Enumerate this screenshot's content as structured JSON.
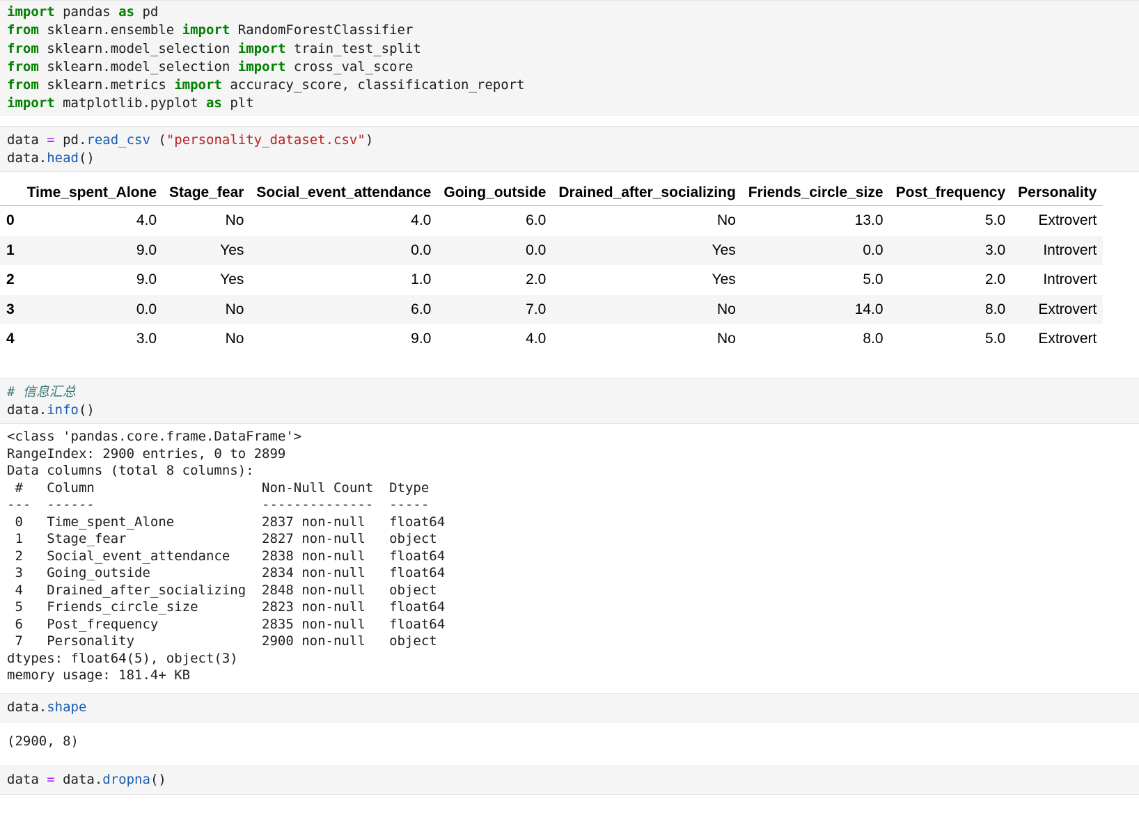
{
  "cell1": {
    "lines": [
      [
        {
          "t": "import",
          "c": "kw"
        },
        {
          "t": " pandas "
        },
        {
          "t": "as",
          "c": "kw"
        },
        {
          "t": " pd"
        }
      ],
      [
        {
          "t": "from",
          "c": "kw"
        },
        {
          "t": " sklearn.ensemble "
        },
        {
          "t": "import",
          "c": "kw"
        },
        {
          "t": " RandomForestClassifier"
        }
      ],
      [
        {
          "t": "from",
          "c": "kw"
        },
        {
          "t": " sklearn.model_selection "
        },
        {
          "t": "import",
          "c": "kw"
        },
        {
          "t": " train_test_split"
        }
      ],
      [
        {
          "t": "from",
          "c": "kw"
        },
        {
          "t": " sklearn.model_selection "
        },
        {
          "t": "import",
          "c": "kw"
        },
        {
          "t": " cross_val_score"
        }
      ],
      [
        {
          "t": "from",
          "c": "kw"
        },
        {
          "t": " sklearn.metrics "
        },
        {
          "t": "import",
          "c": "kw"
        },
        {
          "t": " accuracy_score, classification_report"
        }
      ],
      [
        {
          "t": "import",
          "c": "kw"
        },
        {
          "t": " matplotlib.pyplot "
        },
        {
          "t": "as",
          "c": "kw"
        },
        {
          "t": " plt"
        }
      ]
    ]
  },
  "cell2": {
    "lines": [
      [
        {
          "t": "data "
        },
        {
          "t": "=",
          "c": "op"
        },
        {
          "t": " pd."
        },
        {
          "t": "read_csv",
          "c": "fn"
        },
        {
          "t": " ("
        },
        {
          "t": "\"personality_dataset.csv\"",
          "c": "str"
        },
        {
          "t": ")"
        }
      ],
      [
        {
          "t": "data."
        },
        {
          "t": "head",
          "c": "fn"
        },
        {
          "t": "()"
        }
      ]
    ]
  },
  "table": {
    "columns": [
      "",
      "Time_spent_Alone",
      "Stage_fear",
      "Social_event_attendance",
      "Going_outside",
      "Drained_after_socializing",
      "Friends_circle_size",
      "Post_frequency",
      "Personality"
    ],
    "rows": [
      [
        "0",
        "4.0",
        "No",
        "4.0",
        "6.0",
        "No",
        "13.0",
        "5.0",
        "Extrovert"
      ],
      [
        "1",
        "9.0",
        "Yes",
        "0.0",
        "0.0",
        "Yes",
        "0.0",
        "3.0",
        "Introvert"
      ],
      [
        "2",
        "9.0",
        "Yes",
        "1.0",
        "2.0",
        "Yes",
        "5.0",
        "2.0",
        "Introvert"
      ],
      [
        "3",
        "0.0",
        "No",
        "6.0",
        "7.0",
        "No",
        "14.0",
        "8.0",
        "Extrovert"
      ],
      [
        "4",
        "3.0",
        "No",
        "9.0",
        "4.0",
        "No",
        "8.0",
        "5.0",
        "Extrovert"
      ]
    ]
  },
  "cell3": {
    "lines": [
      [
        {
          "t": "# 信息汇总",
          "c": "cm"
        }
      ],
      [
        {
          "t": "data."
        },
        {
          "t": "info",
          "c": "fn"
        },
        {
          "t": "()"
        }
      ]
    ]
  },
  "info_output": [
    "<class 'pandas.core.frame.DataFrame'>",
    "RangeIndex: 2900 entries, 0 to 2899",
    "Data columns (total 8 columns):",
    " #   Column                     Non-Null Count  Dtype  ",
    "---  ------                     --------------  -----  ",
    " 0   Time_spent_Alone           2837 non-null   float64",
    " 1   Stage_fear                 2827 non-null   object ",
    " 2   Social_event_attendance    2838 non-null   float64",
    " 3   Going_outside              2834 non-null   float64",
    " 4   Drained_after_socializing  2848 non-null   object ",
    " 5   Friends_circle_size        2823 non-null   float64",
    " 6   Post_frequency             2835 non-null   float64",
    " 7   Personality                2900 non-null   object ",
    "dtypes: float64(5), object(3)",
    "memory usage: 181.4+ KB"
  ],
  "cell4": {
    "lines": [
      [
        {
          "t": "data."
        },
        {
          "t": "shape",
          "c": "fn"
        }
      ]
    ]
  },
  "shape_output": "(2900, 8)",
  "cell5": {
    "lines": [
      [
        {
          "t": "data "
        },
        {
          "t": "=",
          "c": "op"
        },
        {
          "t": " data."
        },
        {
          "t": "dropna",
          "c": "fn"
        },
        {
          "t": "()"
        }
      ]
    ]
  }
}
